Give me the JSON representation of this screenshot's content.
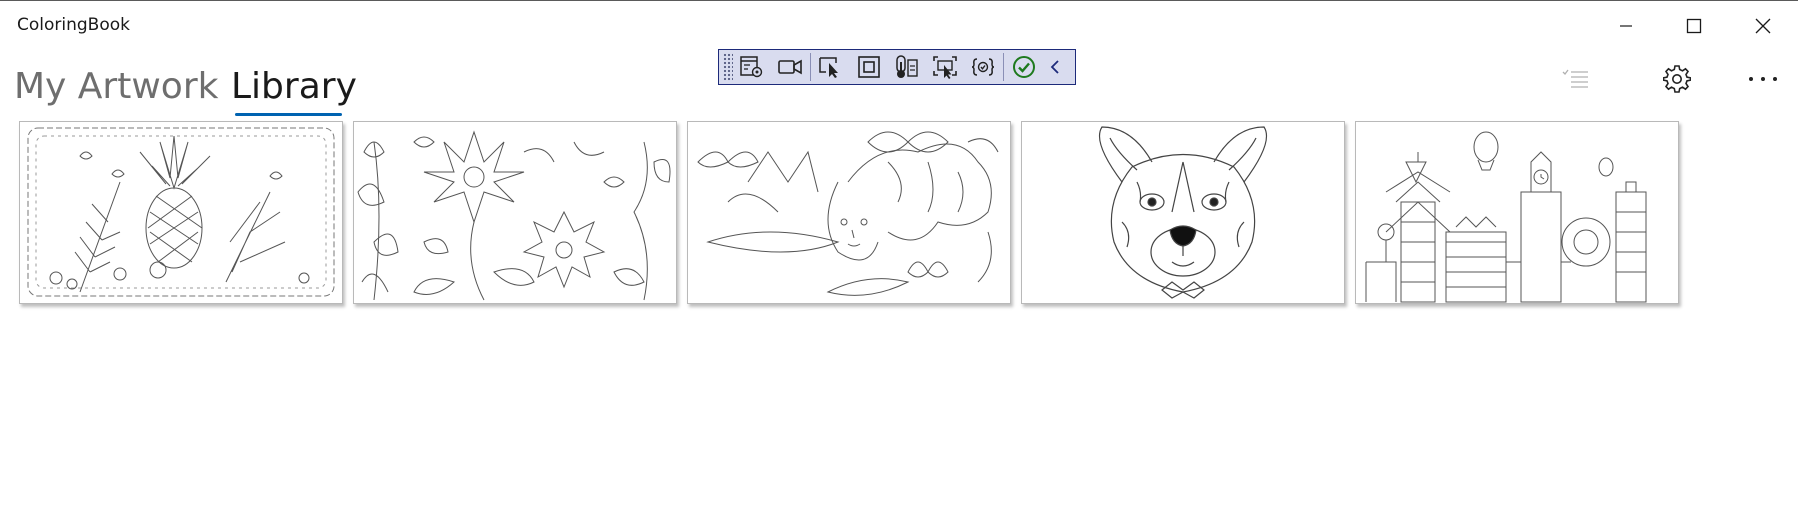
{
  "window": {
    "title": "ColoringBook",
    "controls": {
      "minimize_icon": "minimize-icon",
      "maximize_icon": "maximize-icon",
      "close_icon": "close-icon"
    }
  },
  "tabs": [
    {
      "label": "My Artwork",
      "selected": false
    },
    {
      "label": "Library",
      "selected": true
    }
  ],
  "accent_color": "#0063b1",
  "debug_toolbar": {
    "buttons": [
      "live-visual-tree-icon",
      "video-camera-icon",
      "select-element-icon",
      "display-layout-adorners-icon",
      "temperature-icon",
      "track-focus-icon",
      "binding-icon",
      "checkmark-icon",
      "collapse-chevron-icon"
    ]
  },
  "command_bar": {
    "buttons": [
      "checklist-icon",
      "gear-icon",
      "more-icon"
    ]
  },
  "library": {
    "items": [
      {
        "name": "Pineapple"
      },
      {
        "name": "Flowers"
      },
      {
        "name": "Woman with butterflies"
      },
      {
        "name": "Dog"
      },
      {
        "name": "Town"
      }
    ]
  }
}
